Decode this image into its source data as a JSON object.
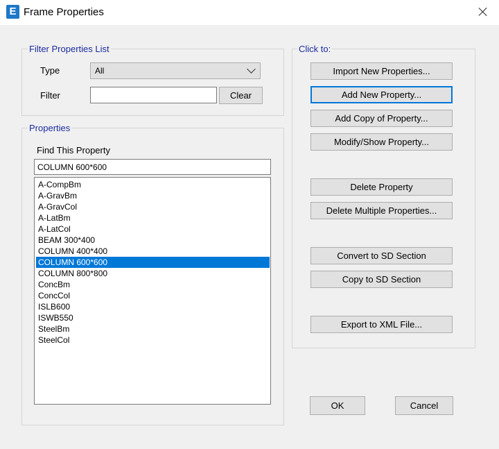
{
  "window": {
    "title": "Frame Properties",
    "app_icon_letter": "E"
  },
  "filter": {
    "group_label": "Filter Properties List",
    "type_label": "Type",
    "type_value": "All",
    "filter_label": "Filter",
    "filter_value": "",
    "clear_label": "Clear"
  },
  "properties": {
    "group_label": "Properties",
    "find_label": "Find This Property",
    "find_value": "COLUMN 600*600",
    "items": [
      "A-CompBm",
      "A-GravBm",
      "A-GravCol",
      "A-LatBm",
      "A-LatCol",
      "BEAM 300*400",
      "COLUMN 400*400",
      "COLUMN 600*600",
      "COLUMN 800*800",
      "ConcBm",
      "ConcCol",
      "ISLB600",
      "ISWB550",
      "SteelBm",
      "SteelCol"
    ],
    "selected": "COLUMN 600*600"
  },
  "actions": {
    "group_label": "Click to:",
    "import_new": "Import New Properties...",
    "add_new": "Add New Property...",
    "add_copy": "Add Copy of Property...",
    "modify_show": "Modify/Show Property...",
    "delete": "Delete Property",
    "delete_multiple": "Delete Multiple Properties...",
    "convert_sd": "Convert to SD Section",
    "copy_sd": "Copy to SD Section",
    "export_xml": "Export to XML File..."
  },
  "footer": {
    "ok": "OK",
    "cancel": "Cancel"
  },
  "colors": {
    "accent": "#0078d7",
    "legend": "#1b2b9e",
    "app_icon": "#1e78c8"
  }
}
